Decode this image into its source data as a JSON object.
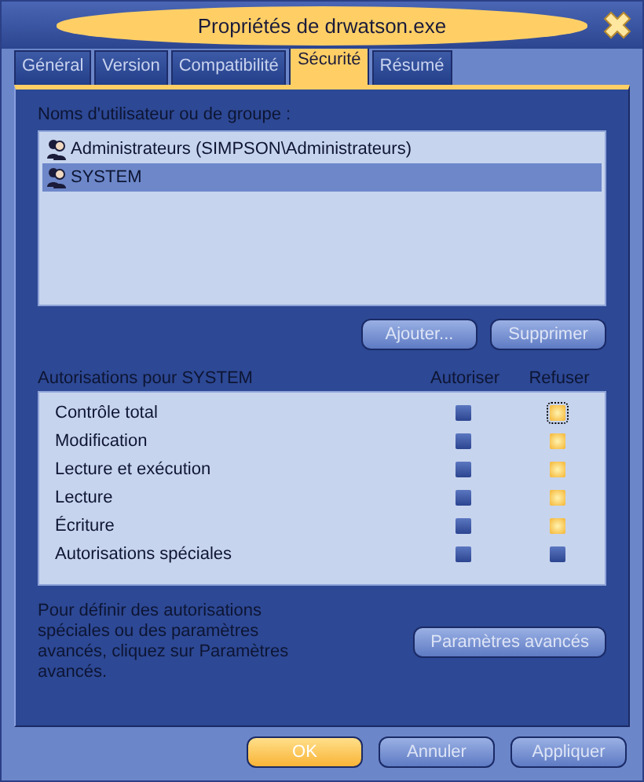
{
  "window": {
    "title": "Propriétés de drwatson.exe"
  },
  "tabs": [
    {
      "label": "Général",
      "selected": false
    },
    {
      "label": "Version",
      "selected": false
    },
    {
      "label": "Compatibilité",
      "selected": false
    },
    {
      "label": "Sécurité",
      "selected": true
    },
    {
      "label": "Résumé",
      "selected": false
    }
  ],
  "users": {
    "label": "Noms d'utilisateur ou de groupe :",
    "items": [
      {
        "name": "Administrateurs (SIMPSON\\Administrateurs)",
        "selected": false
      },
      {
        "name": "SYSTEM",
        "selected": true
      }
    ],
    "buttons": [
      "Ajouter...",
      "Supprimer"
    ]
  },
  "permissions": {
    "label": "Autorisations pour SYSTEM",
    "columns": [
      "Autoriser",
      "Refuser"
    ],
    "rows": [
      {
        "name": "Contrôle total",
        "allow": false,
        "deny": true,
        "focused": true
      },
      {
        "name": "Modification",
        "allow": false,
        "deny": true,
        "focused": false
      },
      {
        "name": "Lecture et exécution",
        "allow": false,
        "deny": true,
        "focused": false
      },
      {
        "name": "Lecture",
        "allow": false,
        "deny": true,
        "focused": false
      },
      {
        "name": "Écriture",
        "allow": false,
        "deny": true,
        "focused": false
      },
      {
        "name": "Autorisations spéciales",
        "allow": false,
        "deny": false,
        "focused": false
      }
    ]
  },
  "advanced": {
    "text": "Pour définir des autorisations spéciales ou des paramètres avancés, cliquez sur Paramètres avancés.",
    "button": "Paramètres avancés"
  },
  "footer_buttons": [
    {
      "label": "OK",
      "default": true
    },
    {
      "label": "Annuler",
      "default": false
    },
    {
      "label": "Appliquer",
      "default": false
    }
  ]
}
